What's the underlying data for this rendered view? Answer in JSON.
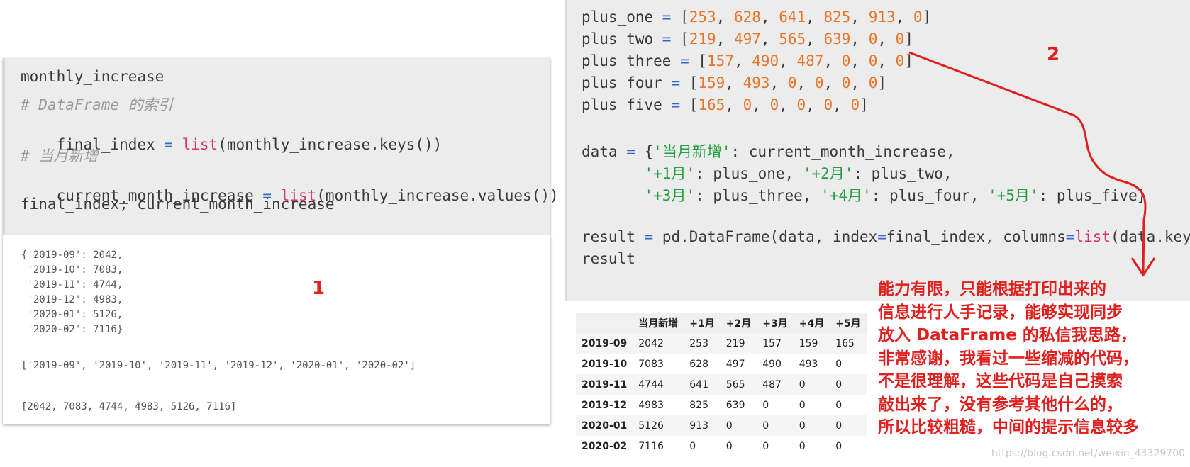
{
  "left_cell": {
    "code": [
      "monthly_increase",
      "# DataFrame 的索引",
      "final_index = list(monthly_increase.keys())",
      "# 当月新增",
      "current_month_increase = list(monthly_increase.values())",
      "final_index; current_month_increase"
    ],
    "output": {
      "dict_lines": [
        "{'2019-09': 2042,",
        " '2019-10': 7083,",
        " '2019-11': 4744,",
        " '2019-12': 4983,",
        " '2020-01': 5126,",
        " '2020-02': 7116}"
      ],
      "index_list": "['2019-09', '2019-10', '2019-11', '2019-12', '2020-01', '2020-02']",
      "values_list": "[2042, 7083, 4744, 4983, 5126, 7116]"
    }
  },
  "right_cell": {
    "code": [
      "plus_one = [253, 628, 641, 825, 913, 0]",
      "plus_two = [219, 497, 565, 639, 0, 0]",
      "plus_three = [157, 490, 487, 0, 0, 0]",
      "plus_four = [159, 493, 0, 0, 0, 0]",
      "plus_five = [165, 0, 0, 0, 0, 0]",
      "",
      "data = {'当月新增': current_month_increase,",
      "       '+1月': plus_one, '+2月': plus_two,",
      "       '+3月': plus_three, '+4月': plus_four, '+5月': plus_five}",
      "",
      "result = pd.DataFrame(data, index=final_index, columns=list(data.keys()))",
      "result"
    ],
    "table": {
      "columns": [
        "",
        "当月新增",
        "+1月",
        "+2月",
        "+3月",
        "+4月",
        "+5月"
      ],
      "rows": [
        {
          "index": "2019-09",
          "values": [
            "2042",
            "253",
            "219",
            "157",
            "159",
            "165"
          ]
        },
        {
          "index": "2019-10",
          "values": [
            "7083",
            "628",
            "497",
            "490",
            "493",
            "0"
          ]
        },
        {
          "index": "2019-11",
          "values": [
            "4744",
            "641",
            "565",
            "487",
            "0",
            "0"
          ]
        },
        {
          "index": "2019-12",
          "values": [
            "4983",
            "825",
            "639",
            "0",
            "0",
            "0"
          ]
        },
        {
          "index": "2020-01",
          "values": [
            "5126",
            "913",
            "0",
            "0",
            "0",
            "0"
          ]
        },
        {
          "index": "2020-02",
          "values": [
            "7116",
            "0",
            "0",
            "0",
            "0",
            "0"
          ]
        }
      ]
    }
  },
  "annotations": {
    "label_one": "1",
    "label_two": "2",
    "note_lines": [
      "能力有限，只能根据打印出来的",
      "信息进行人手记录，能够实现同步",
      "放入 DataFrame 的私信我思路，",
      "非常感谢，我看过一些缩减的代码，",
      "不是很理解，这些代码是自己摸索",
      "敲出来了，没有参考其他什么的，",
      "所以比较粗糙，中间的提示信息较多"
    ],
    "color": "#e0201f"
  },
  "watermark": "https://blog.csdn.net/weixin_43329700"
}
